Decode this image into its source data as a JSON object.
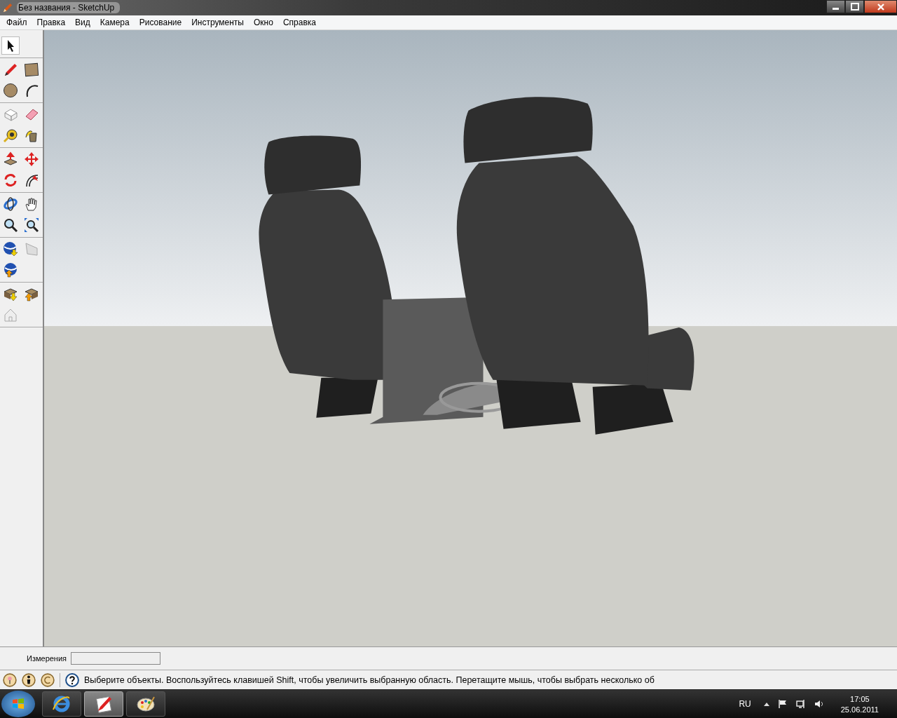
{
  "window": {
    "title": "Без названия - SketchUp"
  },
  "menu": [
    "Файл",
    "Правка",
    "Вид",
    "Камера",
    "Рисование",
    "Инструменты",
    "Окно",
    "Справка"
  ],
  "toolbar": {
    "groups": [
      [
        {
          "kind": "select",
          "selected": true
        }
      ],
      [
        {
          "kind": "pencil",
          "selected": false
        },
        {
          "kind": "rectangle",
          "selected": false
        },
        {
          "kind": "circle",
          "selected": false
        },
        {
          "kind": "arc",
          "selected": false
        }
      ],
      [
        {
          "kind": "component",
          "selected": false
        },
        {
          "kind": "eraser",
          "selected": false
        },
        {
          "kind": "tape",
          "selected": false
        },
        {
          "kind": "bucket",
          "selected": false
        }
      ],
      [
        {
          "kind": "pushpull",
          "selected": false
        },
        {
          "kind": "move",
          "selected": false
        },
        {
          "kind": "rotate",
          "selected": false
        },
        {
          "kind": "offset",
          "selected": false
        }
      ],
      [
        {
          "kind": "orbit",
          "selected": false
        },
        {
          "kind": "pan",
          "selected": false
        },
        {
          "kind": "zoom",
          "selected": false
        },
        {
          "kind": "zoomext",
          "selected": false
        }
      ],
      [
        {
          "kind": "globedown",
          "selected": false
        },
        {
          "kind": "page",
          "selected": false
        },
        {
          "kind": "globeup",
          "selected": false
        }
      ],
      [
        {
          "kind": "boxdown",
          "selected": false
        },
        {
          "kind": "boxup",
          "selected": false
        },
        {
          "kind": "house",
          "selected": false
        }
      ]
    ]
  },
  "measurements": {
    "label": "Измерения"
  },
  "status_bar": {
    "message": "Выберите объекты. Воспользуйтесь клавишей Shift, чтобы увеличить выбранную область. Перетащите мышь, чтобы выбрать несколько об"
  },
  "taskbar": {
    "apps": [
      {
        "kind": "ie",
        "selected": false
      },
      {
        "kind": "sketchup",
        "selected": true
      },
      {
        "kind": "paint",
        "selected": false
      }
    ],
    "language": "RU",
    "time": "17:05",
    "date": "25.06.2011"
  }
}
